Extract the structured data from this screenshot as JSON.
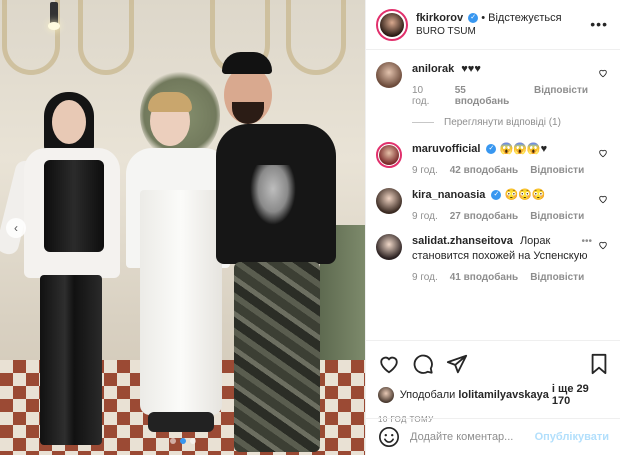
{
  "post": {
    "carousel": {
      "prev_icon": "chevron-left-icon",
      "slides": 3,
      "active_slide": 1
    }
  },
  "header": {
    "username": "fkirkorov",
    "separator": "•",
    "follow_status": "Відстежується",
    "location": "BURO TSUM",
    "more_icon": "ellipsis-icon"
  },
  "comments": [
    {
      "user": "anilorak",
      "text": "♥♥♥",
      "time": "10 год.",
      "likes": "55 вподобань",
      "reply": "Відповісти"
    },
    {
      "user": "maruvofficial",
      "text": "😱😱😱♥",
      "time": "9 год.",
      "likes": "42 вподобань",
      "reply": "Відповісти"
    },
    {
      "user": "kira_nanoasia",
      "text": "😳😳😳",
      "time": "9 год.",
      "likes": "27 вподобань",
      "reply": "Відповісти"
    },
    {
      "user": "salidat.zhanseitova",
      "text": "Лорак становится похожей на Успенскую",
      "time": "9 год.",
      "likes": "41 вподобань",
      "reply": "Відповісти"
    }
  ],
  "view_replies": "Переглянути відповіді (1)",
  "likes": {
    "prefix": "Уподобали",
    "user": "lolitamilyavskaya",
    "suffix": "і ще 29 170"
  },
  "timestamp": "10 год тому",
  "add_comment": {
    "placeholder": "Додайте коментар...",
    "submit": "Опублікувати"
  },
  "colors": {
    "link_blue": "#3897f0",
    "disabled_blue": "#b2dffc",
    "muted": "#8e8e8e",
    "story_ring": "#e1306c"
  }
}
